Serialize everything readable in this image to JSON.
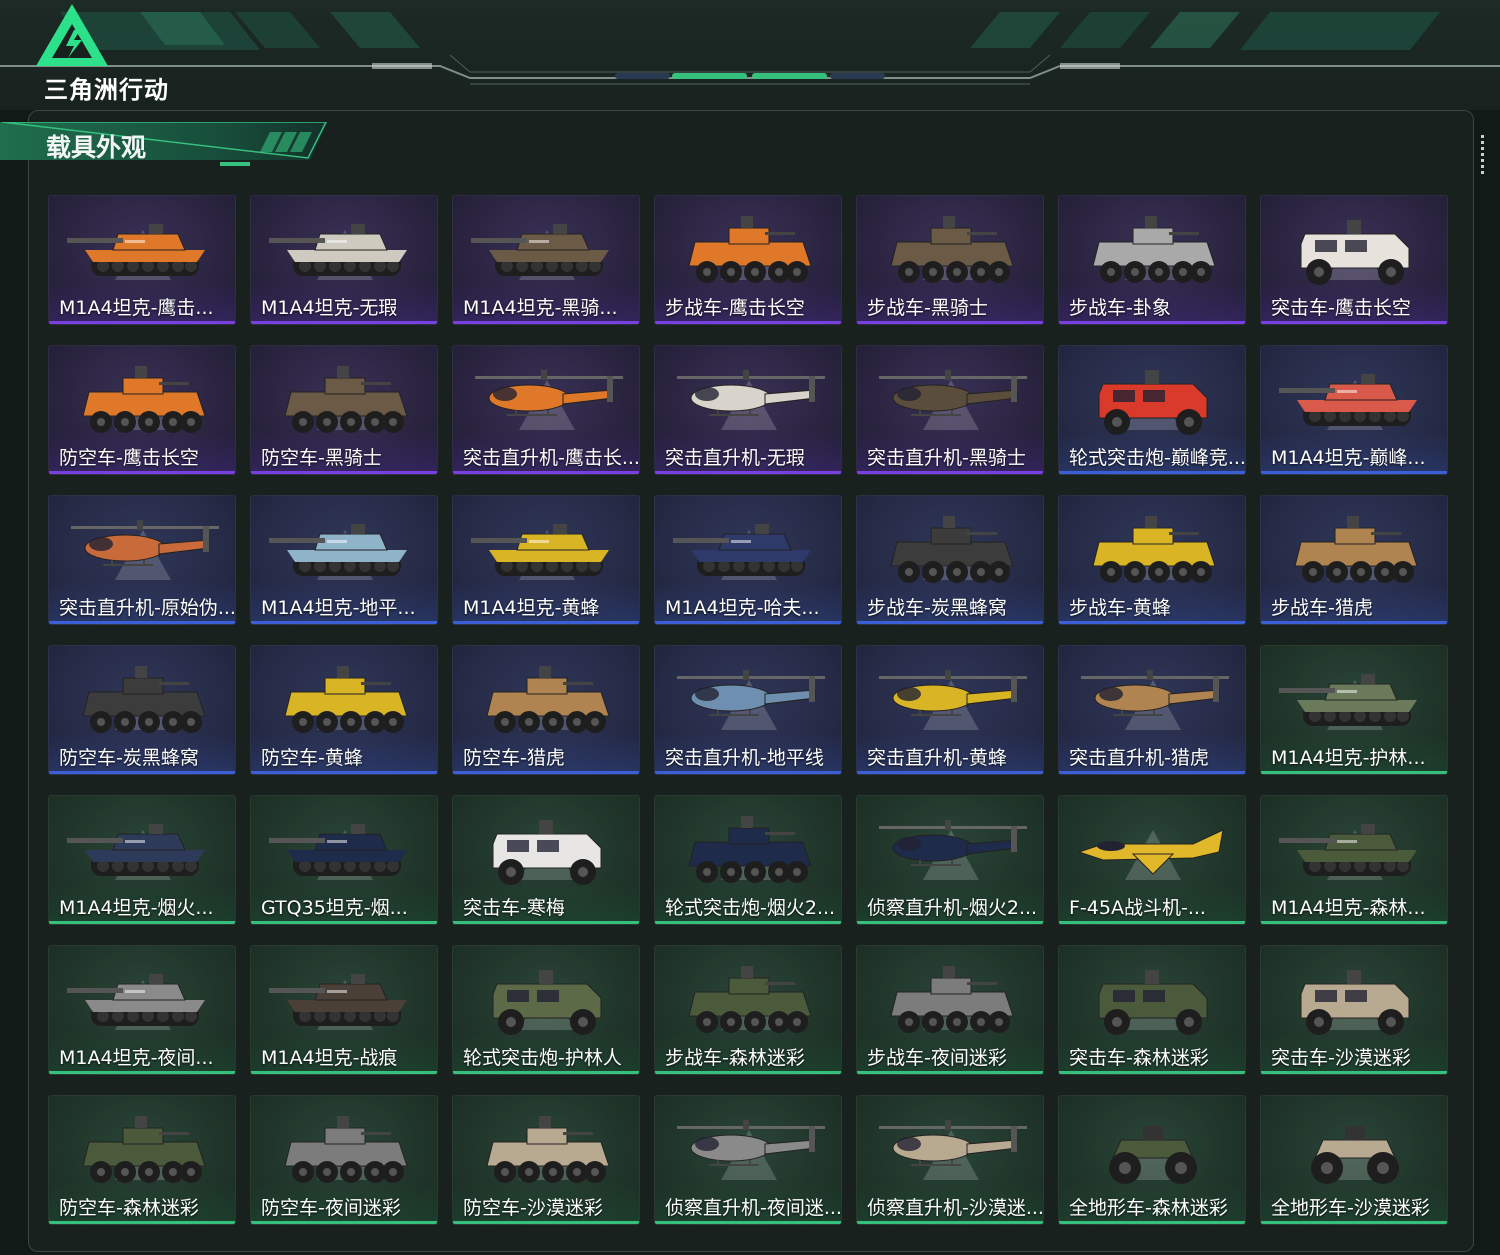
{
  "app": {
    "logo_text": "三角洲行动",
    "accent": "#35c07e"
  },
  "section": {
    "title": "载具外观"
  },
  "colors": {
    "purple_tier": "#7a3fe0",
    "blue_tier": "#3c5fd6",
    "green_tier": "#35c07e"
  },
  "items": [
    {
      "label": "M1A4坦克-鹰击...",
      "tier": "purple",
      "kind": "tank",
      "camo": "#e0782a"
    },
    {
      "label": "M1A4坦克-无瑕",
      "tier": "purple",
      "kind": "tank",
      "camo": "#cfcac0"
    },
    {
      "label": "M1A4坦克-黑骑...",
      "tier": "purple",
      "kind": "tank",
      "camo": "#6b5a45"
    },
    {
      "label": "步战车-鹰击长空",
      "tier": "purple",
      "kind": "ifv",
      "camo": "#e0782a"
    },
    {
      "label": "步战车-黑骑士",
      "tier": "purple",
      "kind": "ifv",
      "camo": "#6b5a45"
    },
    {
      "label": "步战车-卦象",
      "tier": "purple",
      "kind": "ifv",
      "camo": "#a9a9a9"
    },
    {
      "label": "突击车-鹰击长空",
      "tier": "purple",
      "kind": "truck",
      "camo": "#e8e2dc"
    },
    {
      "label": "防空车-鹰击长空",
      "tier": "purple",
      "kind": "ifv",
      "camo": "#e0782a"
    },
    {
      "label": "防空车-黑骑士",
      "tier": "purple",
      "kind": "ifv",
      "camo": "#6b5a45"
    },
    {
      "label": "突击直升机-鹰击长...",
      "tier": "purple",
      "kind": "heli",
      "camo": "#e0782a"
    },
    {
      "label": "突击直升机-无瑕",
      "tier": "purple",
      "kind": "heli",
      "camo": "#d8d4cc"
    },
    {
      "label": "突击直升机-黑骑士",
      "tier": "purple",
      "kind": "heli",
      "camo": "#5a4d3c"
    },
    {
      "label": "轮式突击炮-巅峰竞...",
      "tier": "blue",
      "kind": "truck",
      "camo": "#d93a2a"
    },
    {
      "label": "M1A4坦克-巅峰...",
      "tier": "blue",
      "kind": "tank",
      "camo": "#d95a4a"
    },
    {
      "label": "突击直升机-原始伪...",
      "tier": "blue",
      "kind": "heli",
      "camo": "#c86a3a"
    },
    {
      "label": "M1A4坦克-地平...",
      "tier": "blue",
      "kind": "tank",
      "camo": "#8fb3c8"
    },
    {
      "label": "M1A4坦克-黄蜂",
      "tier": "blue",
      "kind": "tank",
      "camo": "#d9b526"
    },
    {
      "label": "M1A4坦克-哈夫...",
      "tier": "blue",
      "kind": "tank",
      "camo": "#2d3a6a"
    },
    {
      "label": "步战车-炭黑蜂窝",
      "tier": "blue",
      "kind": "ifv",
      "camo": "#3c3c3c"
    },
    {
      "label": "步战车-黄蜂",
      "tier": "blue",
      "kind": "ifv",
      "camo": "#d9b526"
    },
    {
      "label": "步战车-猎虎",
      "tier": "blue",
      "kind": "ifv",
      "camo": "#b08450"
    },
    {
      "label": "防空车-炭黑蜂窝",
      "tier": "blue",
      "kind": "ifv",
      "camo": "#3c3c3c"
    },
    {
      "label": "防空车-黄蜂",
      "tier": "blue",
      "kind": "ifv",
      "camo": "#d9b526"
    },
    {
      "label": "防空车-猎虎",
      "tier": "blue",
      "kind": "ifv",
      "camo": "#b08450"
    },
    {
      "label": "突击直升机-地平线",
      "tier": "blue",
      "kind": "heli",
      "camo": "#6f8fb0"
    },
    {
      "label": "突击直升机-黄蜂",
      "tier": "blue",
      "kind": "heli",
      "camo": "#d9b526"
    },
    {
      "label": "突击直升机-猎虎",
      "tier": "blue",
      "kind": "heli",
      "camo": "#b08450"
    },
    {
      "label": "M1A4坦克-护林...",
      "tier": "green",
      "kind": "tank",
      "camo": "#6a7a5a"
    },
    {
      "label": "M1A4坦克-烟火...",
      "tier": "green",
      "kind": "tank",
      "camo": "#2d3a5a"
    },
    {
      "label": "GTQ35坦克-烟...",
      "tier": "green",
      "kind": "tank",
      "camo": "#1f2b4a"
    },
    {
      "label": "突击车-寒梅",
      "tier": "green",
      "kind": "truck",
      "camo": "#e8e6e4"
    },
    {
      "label": "轮式突击炮-烟火2...",
      "tier": "green",
      "kind": "ifv",
      "camo": "#1f2b4a"
    },
    {
      "label": "侦察直升机-烟火2...",
      "tier": "green",
      "kind": "heli",
      "camo": "#1f2b4a"
    },
    {
      "label": "F-45A战斗机-...",
      "tier": "green",
      "kind": "jet",
      "camo": "#e0b82a"
    },
    {
      "label": "M1A4坦克-森林...",
      "tier": "green",
      "kind": "tank",
      "camo": "#4c5a3c"
    },
    {
      "label": "M1A4坦克-夜间...",
      "tier": "green",
      "kind": "tank",
      "camo": "#8a8a8a"
    },
    {
      "label": "M1A4坦克-战痕",
      "tier": "green",
      "kind": "tank",
      "camo": "#4a4038"
    },
    {
      "label": "轮式突击炮-护林人",
      "tier": "green",
      "kind": "truck",
      "camo": "#5c6a48"
    },
    {
      "label": "步战车-森林迷彩",
      "tier": "green",
      "kind": "ifv",
      "camo": "#4c5a3c"
    },
    {
      "label": "步战车-夜间迷彩",
      "tier": "green",
      "kind": "ifv",
      "camo": "#7c7c7c"
    },
    {
      "label": "突击车-森林迷彩",
      "tier": "green",
      "kind": "truck",
      "camo": "#4c5a3c"
    },
    {
      "label": "突击车-沙漠迷彩",
      "tier": "green",
      "kind": "truck",
      "camo": "#b8aa90"
    },
    {
      "label": "防空车-森林迷彩",
      "tier": "green",
      "kind": "ifv",
      "camo": "#4c5a3c"
    },
    {
      "label": "防空车-夜间迷彩",
      "tier": "green",
      "kind": "ifv",
      "camo": "#7c7c7c"
    },
    {
      "label": "防空车-沙漠迷彩",
      "tier": "green",
      "kind": "ifv",
      "camo": "#b8aa90"
    },
    {
      "label": "侦察直升机-夜间迷...",
      "tier": "green",
      "kind": "heli",
      "camo": "#8a8a8a"
    },
    {
      "label": "侦察直升机-沙漠迷...",
      "tier": "green",
      "kind": "heli",
      "camo": "#b8aa90"
    },
    {
      "label": "全地形车-森林迷彩",
      "tier": "green",
      "kind": "atv",
      "camo": "#4c5a3c"
    },
    {
      "label": "全地形车-沙漠迷彩",
      "tier": "green",
      "kind": "atv",
      "camo": "#b8aa90"
    }
  ]
}
